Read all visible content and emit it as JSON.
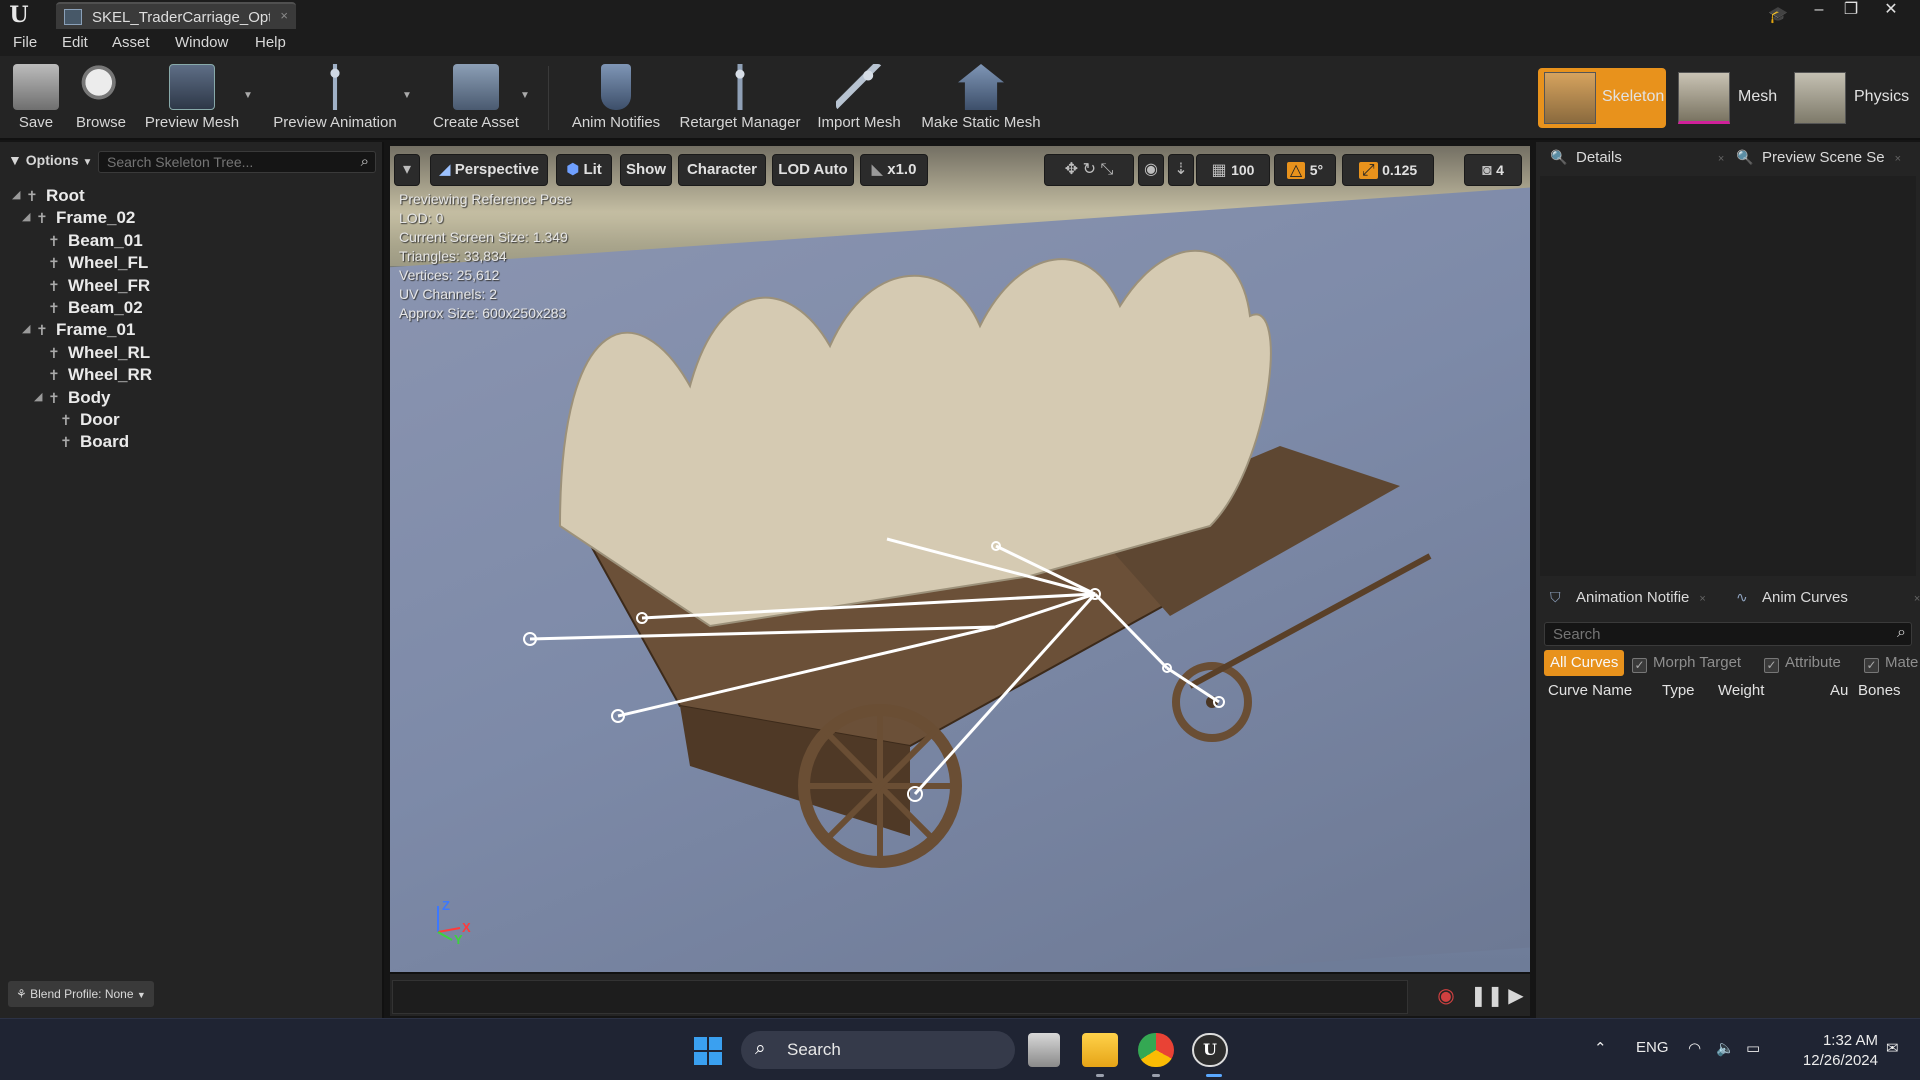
{
  "titlebar": {
    "tab_label": "SKEL_TraderCarriage_Opt",
    "tab_close": "×",
    "minimize": "–",
    "maximize": "❐",
    "close": "✕"
  },
  "menu": [
    "File",
    "Edit",
    "Asset",
    "Window",
    "Help"
  ],
  "toolbar": {
    "save": "Save",
    "browse": "Browse",
    "preview_mesh": "Preview Mesh",
    "preview_animation": "Preview Animation",
    "create_asset": "Create Asset",
    "anim_notifies": "Anim Notifies",
    "retarget_manager": "Retarget Manager",
    "import_mesh": "Import Mesh",
    "make_static_mesh": "Make Static Mesh",
    "modes": {
      "skeleton": "Skeleton",
      "mesh": "Mesh",
      "physics": "Physics"
    },
    "active_color": "#e8921c"
  },
  "skeleton_tree": {
    "options": "Options",
    "search_placeholder": "Search Skeleton Tree...",
    "bones": [
      {
        "name": "Root",
        "depth": 0,
        "expanded": true
      },
      {
        "name": "Frame_02",
        "depth": 1,
        "expanded": true
      },
      {
        "name": "Beam_01",
        "depth": 2
      },
      {
        "name": "Wheel_FL",
        "depth": 2
      },
      {
        "name": "Wheel_FR",
        "depth": 2
      },
      {
        "name": "Beam_02",
        "depth": 2
      },
      {
        "name": "Frame_01",
        "depth": 1,
        "expanded": true
      },
      {
        "name": "Wheel_RL",
        "depth": 2
      },
      {
        "name": "Wheel_RR",
        "depth": 2
      },
      {
        "name": "Body",
        "depth": 2,
        "expanded": true
      },
      {
        "name": "Door",
        "depth": 3
      },
      {
        "name": "Board",
        "depth": 3
      }
    ],
    "blend_profile": "Blend Profile: None"
  },
  "viewport": {
    "perspective": "Perspective",
    "lit": "Lit",
    "show": "Show",
    "character": "Character",
    "lod": "LOD Auto",
    "speed": "x1.0",
    "grid_size": "100",
    "rotation_snap": "5°",
    "scale_snap": "0.125",
    "camera_speed": "4",
    "stats": [
      "Previewing Reference Pose",
      "LOD: 0",
      "Current Screen Size: 1.349",
      "Triangles: 33,834",
      "Vertices: 25,612",
      "UV Channels: 2",
      "Approx Size: 600x250x283"
    ],
    "axes": {
      "z": "Z",
      "x": "X",
      "y": "Y"
    }
  },
  "details": {
    "tab_details": "Details",
    "tab_preview_scene": "Preview Scene Se"
  },
  "anim_curves": {
    "tab_notifies": "Animation Notifie",
    "tab_curves": "Anim Curves",
    "search_placeholder": "Search",
    "filters": [
      "All Curves",
      "Morph Target",
      "Attribute",
      "Mate"
    ],
    "columns": [
      "Curve Name",
      "Type",
      "Weight",
      "Au",
      "Bones"
    ]
  },
  "taskbar": {
    "search": "Search",
    "lang": "ENG",
    "time": "1:32 AM",
    "date": "12/26/2024"
  }
}
